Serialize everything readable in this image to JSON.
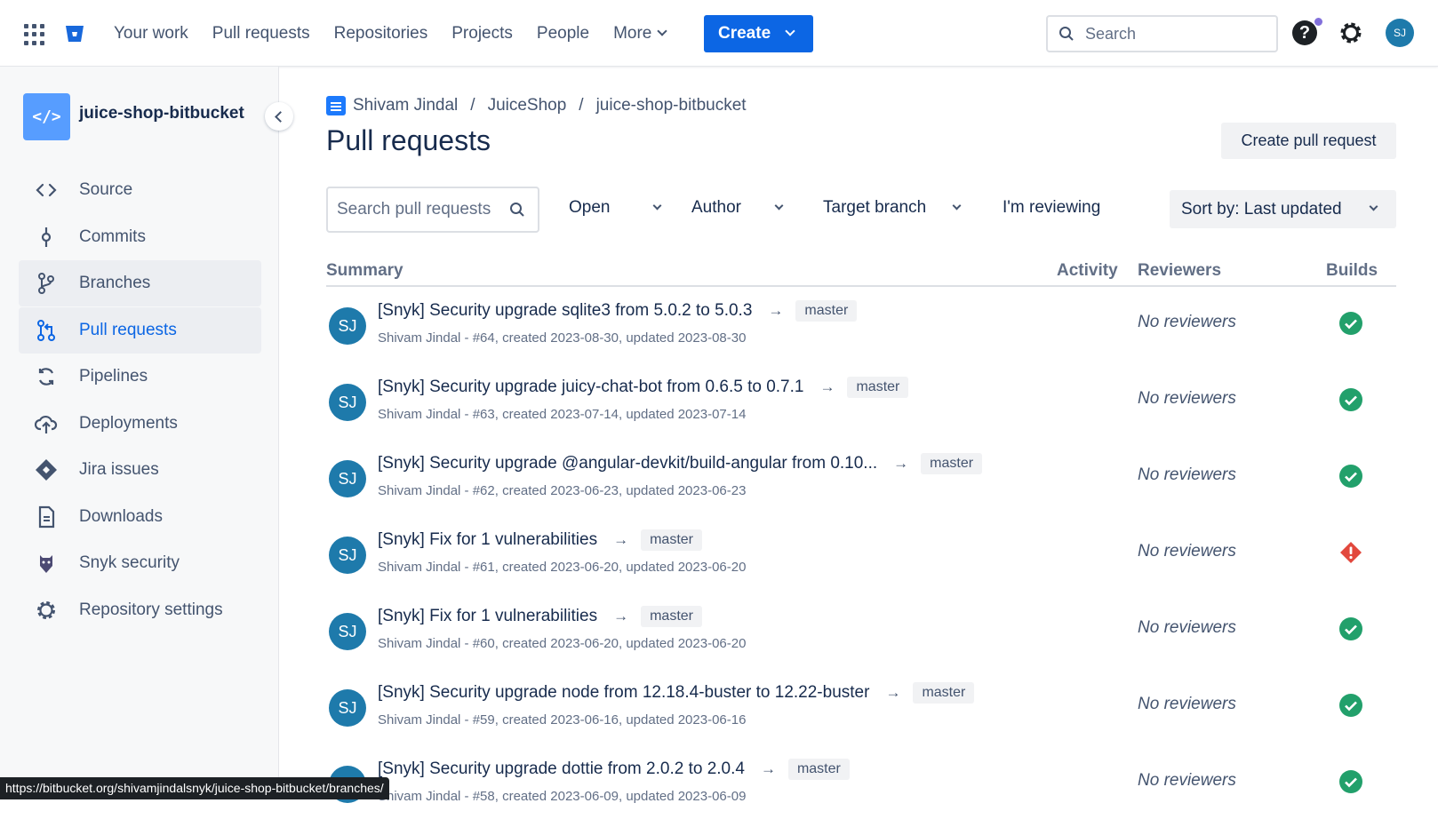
{
  "topnav": {
    "links": [
      "Your work",
      "Pull requests",
      "Repositories",
      "Projects",
      "People"
    ],
    "more_label": "More",
    "create_label": "Create",
    "search_placeholder": "Search",
    "avatar_initials": "SJ",
    "accent": "#0c66e4"
  },
  "sidebar": {
    "repo_name": "juice-shop-bitbucket",
    "repo_icon_text": "</>",
    "items": [
      {
        "label": "Source",
        "icon": "code-icon",
        "state": "normal"
      },
      {
        "label": "Commits",
        "icon": "commit-icon",
        "state": "normal"
      },
      {
        "label": "Branches",
        "icon": "branch-icon",
        "state": "hover"
      },
      {
        "label": "Pull requests",
        "icon": "pull-request-icon",
        "state": "active"
      },
      {
        "label": "Pipelines",
        "icon": "pipelines-icon",
        "state": "normal"
      },
      {
        "label": "Deployments",
        "icon": "cloud-upload-icon",
        "state": "normal"
      },
      {
        "label": "Jira issues",
        "icon": "jira-icon",
        "state": "normal"
      },
      {
        "label": "Downloads",
        "icon": "file-icon",
        "state": "normal"
      },
      {
        "label": "Snyk security",
        "icon": "snyk-icon",
        "state": "normal"
      },
      {
        "label": "Repository settings",
        "icon": "gear-icon",
        "state": "normal"
      }
    ]
  },
  "main": {
    "breadcrumb": [
      "Shivam Jindal",
      "JuiceShop",
      "juice-shop-bitbucket"
    ],
    "title": "Pull requests",
    "create_pr_label": "Create pull request",
    "filters": {
      "search_placeholder": "Search pull requests",
      "state": "Open",
      "author": "Author",
      "target_branch": "Target branch",
      "reviewing": "I'm reviewing",
      "sort": "Sort by: Last updated"
    },
    "columns": [
      "Summary",
      "Activity",
      "Reviewers",
      "Builds"
    ],
    "pull_requests": [
      {
        "initials": "SJ",
        "title": "[Snyk] Security upgrade sqlite3 from 5.0.2 to 5.0.3",
        "branch": "master",
        "meta": "Shivam Jindal - #64, created 2023-08-30, updated 2023-08-30",
        "reviewers": "No reviewers",
        "build": "success"
      },
      {
        "initials": "SJ",
        "title": "[Snyk] Security upgrade juicy-chat-bot from 0.6.5 to 0.7.1",
        "branch": "master",
        "meta": "Shivam Jindal - #63, created 2023-07-14, updated 2023-07-14",
        "reviewers": "No reviewers",
        "build": "success"
      },
      {
        "initials": "SJ",
        "title": "[Snyk] Security upgrade @angular-devkit/build-angular from 0.10...",
        "branch": "master",
        "meta": "Shivam Jindal - #62, created 2023-06-23, updated 2023-06-23",
        "reviewers": "No reviewers",
        "build": "success"
      },
      {
        "initials": "SJ",
        "title": "[Snyk] Fix for 1 vulnerabilities",
        "branch": "master",
        "meta": "Shivam Jindal - #61, created 2023-06-20, updated 2023-06-20",
        "reviewers": "No reviewers",
        "build": "failed"
      },
      {
        "initials": "SJ",
        "title": "[Snyk] Fix for 1 vulnerabilities",
        "branch": "master",
        "meta": "Shivam Jindal - #60, created 2023-06-20, updated 2023-06-20",
        "reviewers": "No reviewers",
        "build": "success"
      },
      {
        "initials": "SJ",
        "title": "[Snyk] Security upgrade node from 12.18.4-buster to 12.22-buster",
        "branch": "master",
        "meta": "Shivam Jindal - #59, created 2023-06-16, updated 2023-06-16",
        "reviewers": "No reviewers",
        "build": "success"
      },
      {
        "initials": "SJ",
        "title": "[Snyk] Security upgrade dottie from 2.0.2 to 2.0.4",
        "branch": "master",
        "meta": "Shivam Jindal - #58, created 2023-06-09, updated 2023-06-09",
        "reviewers": "No reviewers",
        "build": "success"
      }
    ]
  },
  "statusbar_url": "https://bitbucket.org/shivamjindalsnyk/juice-shop-bitbucket/branches/",
  "colors": {
    "success": "#22a06b",
    "failed": "#e2483d"
  }
}
